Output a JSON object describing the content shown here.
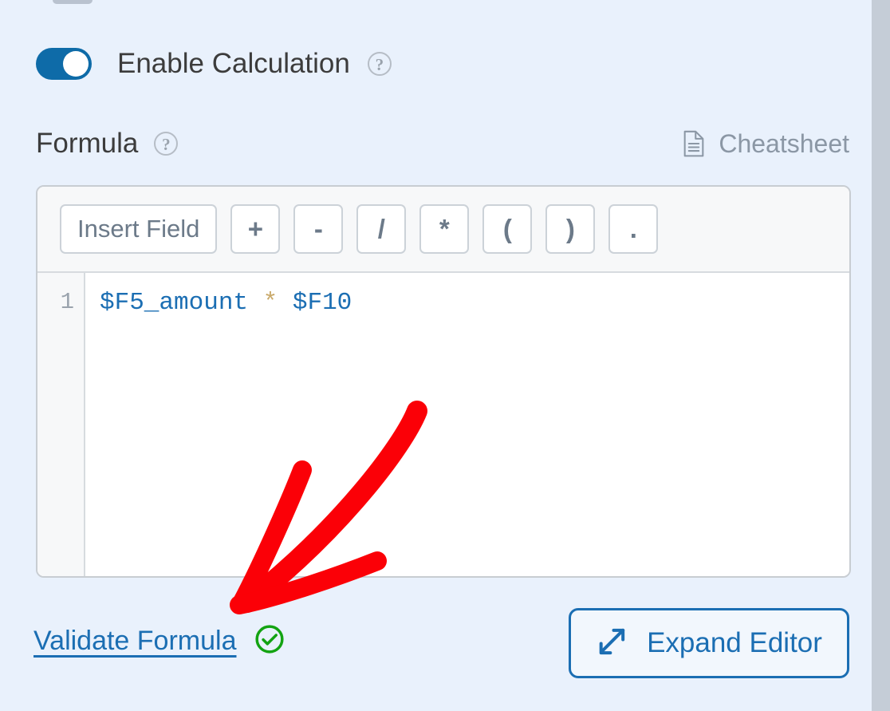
{
  "panel": {
    "background_color": "#e9f1fc",
    "outer_background_color": "#c5cdd7"
  },
  "calculation_toggle": {
    "label": "Enable Calculation",
    "state": "on",
    "accent_color": "#0e6ba8",
    "help_icon": "question-circle-icon",
    "help_glyph": "?"
  },
  "formula_section": {
    "label": "Formula",
    "help_icon": "question-circle-icon",
    "help_glyph": "?",
    "cheatsheet": {
      "label": "Cheatsheet",
      "icon": "document-lines-icon",
      "color": "#8b97a5"
    }
  },
  "editor": {
    "toolbar": [
      {
        "name": "insert-field",
        "label": "Insert Field",
        "kind": "insert"
      },
      {
        "name": "plus",
        "label": "+",
        "kind": "op"
      },
      {
        "name": "minus",
        "label": "-",
        "kind": "op"
      },
      {
        "name": "divide",
        "label": "/",
        "kind": "op"
      },
      {
        "name": "multiply",
        "label": "*",
        "kind": "op"
      },
      {
        "name": "open-paren",
        "label": "(",
        "kind": "op"
      },
      {
        "name": "close-paren",
        "label": ")",
        "kind": "op"
      },
      {
        "name": "dot",
        "label": ".",
        "kind": "op"
      }
    ],
    "line_number": "1",
    "formula_text": "$F5_amount * $F10",
    "tokens": [
      {
        "text": "$F5_amount",
        "type": "variable"
      },
      {
        "text": " ",
        "type": "space"
      },
      {
        "text": "*",
        "type": "operator"
      },
      {
        "text": " ",
        "type": "space"
      },
      {
        "text": "$F10",
        "type": "variable"
      }
    ],
    "variable_color": "#1b6eb3",
    "operator_color": "#c9a96a"
  },
  "footer": {
    "validate": {
      "label": "Validate Formula",
      "link_color": "#1b6eb3",
      "status_icon": "check-circle-icon",
      "status_color": "#13a312"
    },
    "expand": {
      "label": "Expand Editor",
      "icon": "expand-diagonal-arrows-icon",
      "color": "#1b6eb3"
    }
  },
  "annotation": {
    "type": "hand-drawn-arrow",
    "color": "#fb0007",
    "points_to": "validate-formula-link"
  }
}
